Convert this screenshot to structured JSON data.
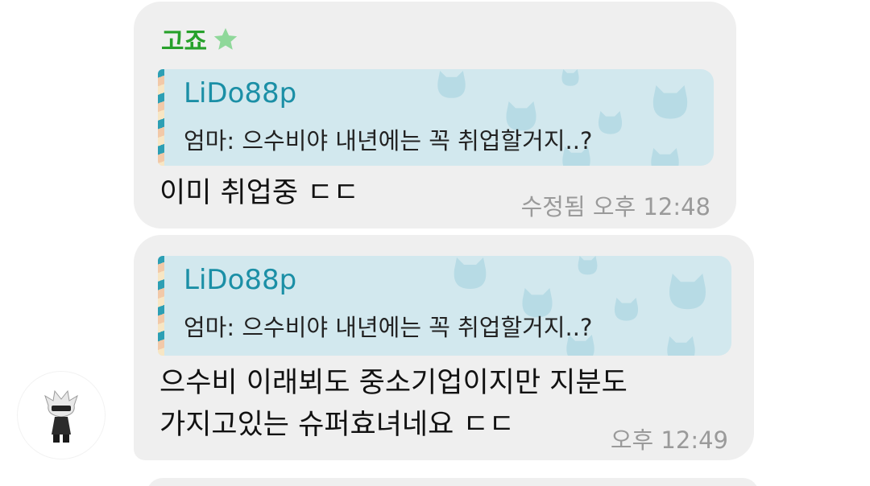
{
  "messages": [
    {
      "sender": "고죠",
      "sender_color": "#27a12b",
      "badge_icon": "star-icon",
      "reply": {
        "author": "LiDo88p",
        "text": "엄마: 으수비야 내년에는 꼭 취업할거지..?"
      },
      "text": "이미 취업중 ㄷㄷ",
      "timestamp": "수정됨 오후 12:48"
    },
    {
      "reply": {
        "author": "LiDo88p",
        "text": "엄마: 으수비야 내년에는 꼭 취업할거지..?"
      },
      "text_line1": "으수비 이래뵈도 중소기업이지만 지분도",
      "text_line2": "가지고있는 슈퍼효녀네요 ㄷㄷ",
      "timestamp": "오후 12:49"
    }
  ],
  "colors": {
    "bubble": "#efefef",
    "reply_bg": "#d2e8ee",
    "reply_author": "#1b8fa6",
    "timestamp": "#9a9a9a"
  }
}
